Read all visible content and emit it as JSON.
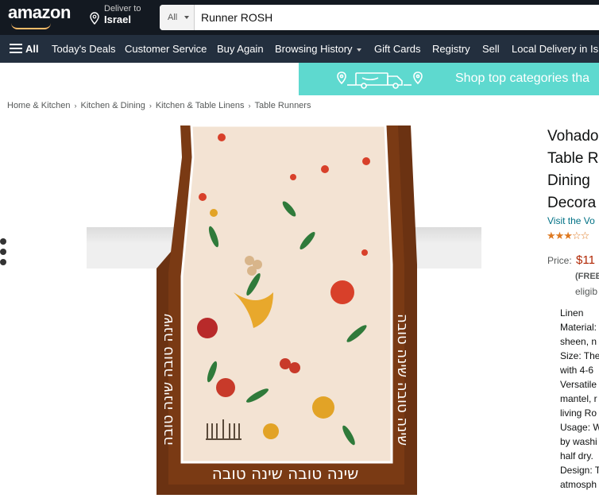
{
  "header": {
    "logo": "amazon",
    "deliver_to_label": "Deliver to",
    "deliver_to_location": "Israel",
    "search_category": "All",
    "search_value": "Runner ROSH"
  },
  "nav": {
    "all": "All",
    "items": [
      "Today's Deals",
      "Customer Service",
      "Buy Again",
      "Browsing History",
      "Gift Cards",
      "Registry",
      "Sell",
      "Local Delivery in Isr"
    ]
  },
  "promo": {
    "text": "Shop top categories tha"
  },
  "breadcrumb": [
    "Home & Kitchen",
    "Kitchen & Dining",
    "Kitchen & Table Linens",
    "Table Runners"
  ],
  "product": {
    "image_text_bottom": "שינה טובה שינה טובה",
    "image_text_side": "שינה טובה שינה טובה",
    "title_lines": [
      "Vohado",
      "Table R",
      "Dining",
      "Decora"
    ],
    "store_link": "Visit the Vo",
    "rating_stars": "★★★☆☆",
    "rating_value": 3.5,
    "price_label": "Price:",
    "price": "$11",
    "free": "(FREE",
    "eligible": "eligib",
    "bullets": [
      "Linen",
      "Material:",
      "sheen, n",
      "Size: The",
      "with 4-6",
      "Versatile",
      "mantel, r",
      "living Ro",
      "Usage: W",
      "by washi",
      "half dry.",
      "Design: T",
      "atmosph"
    ]
  },
  "colors": {
    "topbar": "#131921",
    "navbar": "#232f3e",
    "promo": "#5ed9cf",
    "runner_border": "#7a3a14",
    "price": "#b12704",
    "link": "#007185",
    "star": "#de7921"
  }
}
